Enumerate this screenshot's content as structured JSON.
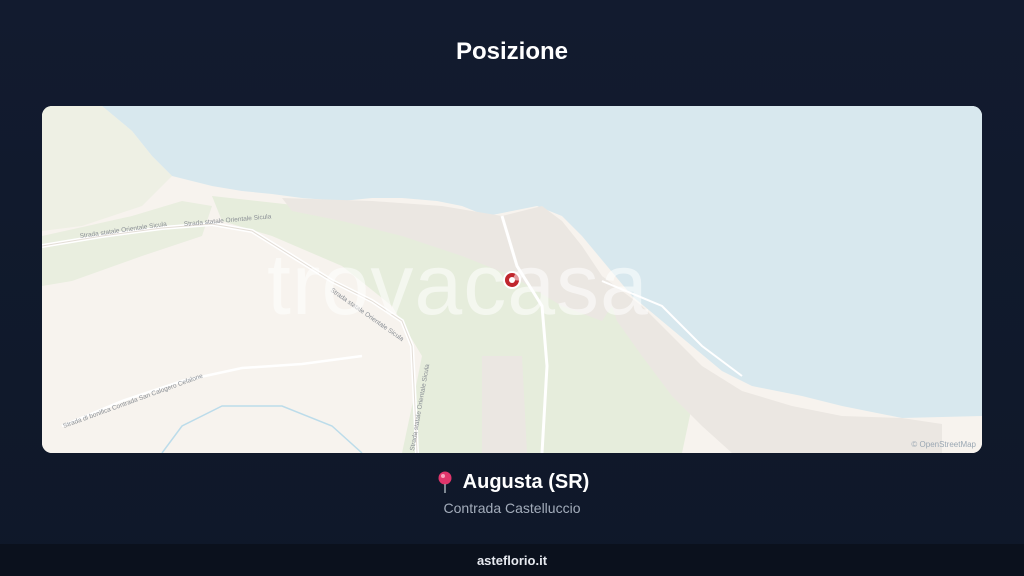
{
  "header": {
    "title": "Posizione"
  },
  "map": {
    "watermark": "trovacasa",
    "attribution": "© OpenStreetMap",
    "road_labels": {
      "strada1": "Strada statale Orientale Sicula",
      "strada2": "Strada statale Orientale Sicula",
      "strada3": "Strada statale Orientale Sicula",
      "strada4": "Strada di bonifica Contrada San Calogero Cefalone",
      "strada5": "Strada statale Orientale Sicula"
    },
    "colors": {
      "sea": "#d8e8ee",
      "land": "#f7f3ee",
      "green": "#e6eddc",
      "urban": "#ebe7e2",
      "marker": "#c0262d"
    },
    "marker_icon": "location-marker-icon"
  },
  "location": {
    "pin_icon": "pushpin-icon",
    "name": "Augusta (SR)",
    "address": "Contrada Castelluccio"
  },
  "footer": {
    "site": "asteflorio.it"
  }
}
